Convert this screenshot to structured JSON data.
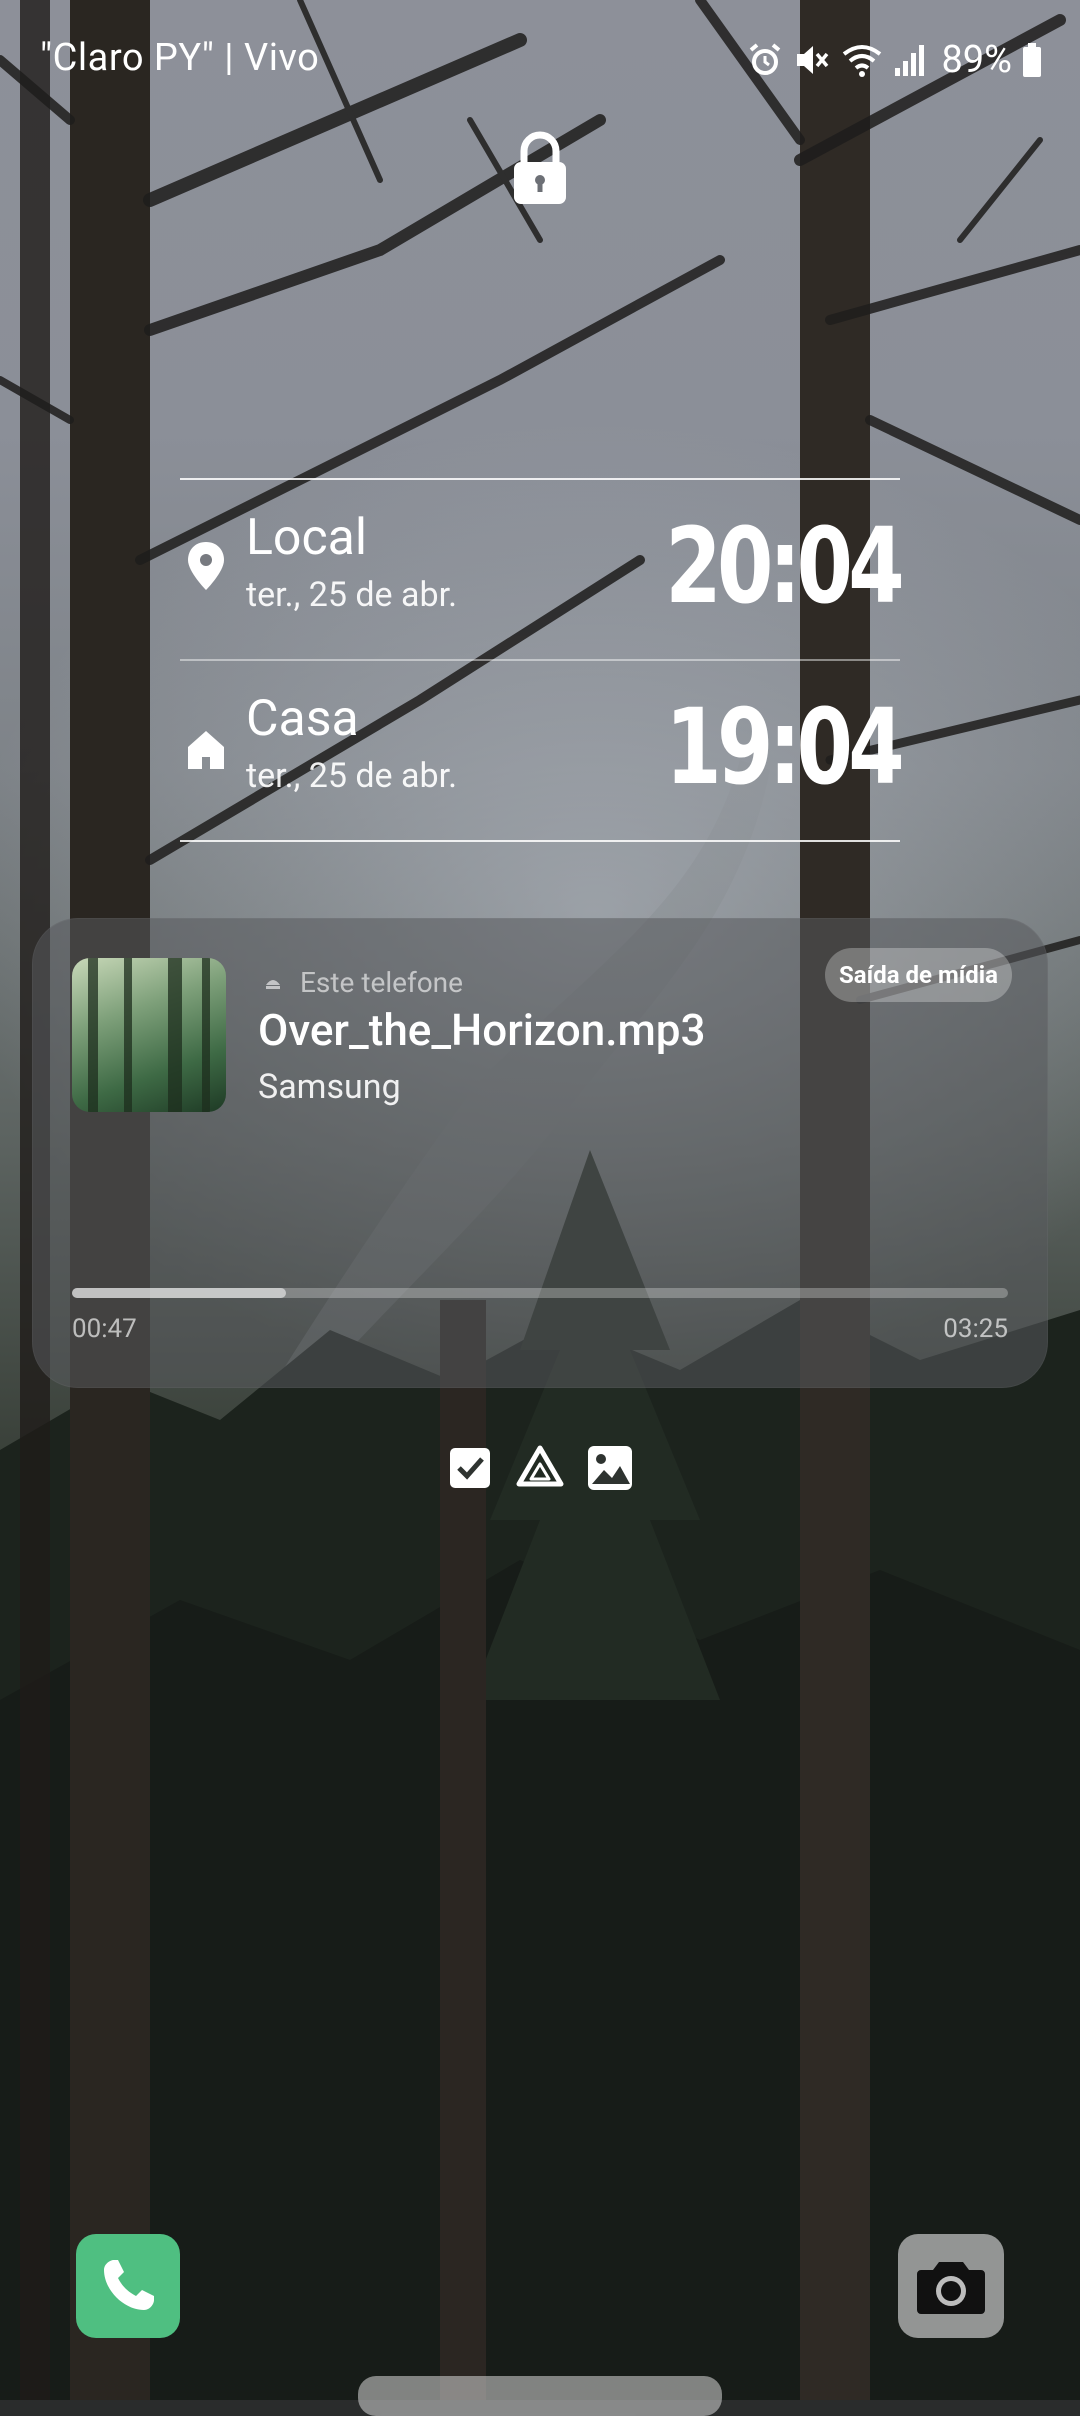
{
  "status_bar": {
    "carrier": "\"Claro PY\" | Vivo",
    "battery_percent": "89%",
    "icons": [
      "alarm-icon",
      "mute-icon",
      "wifi-icon",
      "signal-icon",
      "battery-icon"
    ]
  },
  "lock": {
    "icon": "lock-icon"
  },
  "dual_clock": {
    "rows": [
      {
        "icon": "location-pin-icon",
        "city": "Local",
        "date": "ter., 25 de abr.",
        "time": "20:04"
      },
      {
        "icon": "home-icon",
        "city": "Casa",
        "date": "ter., 25 de abr.",
        "time": "19:04"
      }
    ]
  },
  "media": {
    "source_label": "Este telefone",
    "output_button_label": "Saída de mídia",
    "track_title": "Over_the_Horizon.mp3",
    "artist": "Samsung",
    "elapsed": "00:47",
    "duration": "03:25",
    "progress_fraction": 0.229
  },
  "notification_icons": [
    "checklist-icon",
    "drive-icon",
    "gallery-icon"
  ],
  "shortcuts": {
    "left": "phone-icon",
    "right": "camera-icon"
  },
  "colors": {
    "phone_shortcut": "#4fbf81",
    "camera_shortcut": "#bebebe"
  }
}
